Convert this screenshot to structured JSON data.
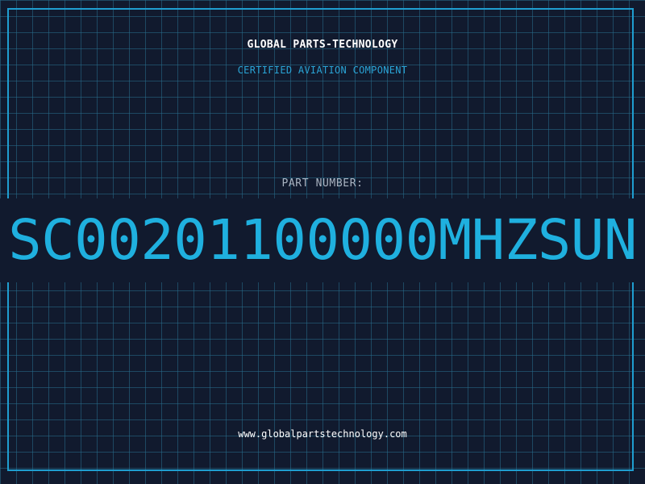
{
  "header": {
    "company_name": "GLOBAL PARTS-TECHNOLOGY",
    "subtitle": "CERTIFIED AVIATION COMPONENT"
  },
  "part": {
    "label": "PART NUMBER:",
    "number": "SC00201100000MHZSUN"
  },
  "footer": {
    "website": "www.globalpartstechnology.com"
  },
  "colors": {
    "background": "#111a2e",
    "grid": "#276e8c",
    "accent": "#1fb0df",
    "frame": "#1f9ed0",
    "label": "#aab4c2",
    "text": "#ffffff"
  }
}
